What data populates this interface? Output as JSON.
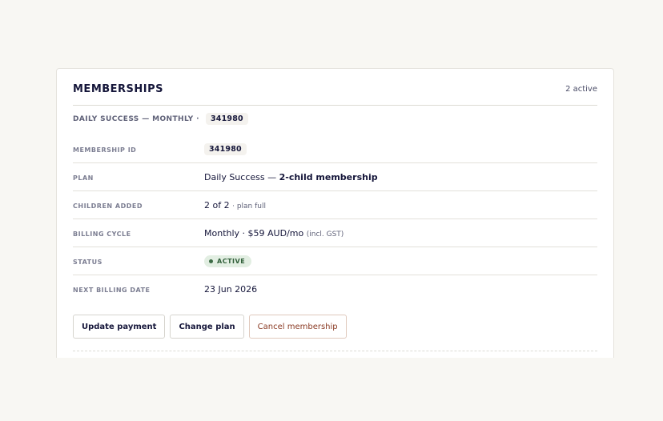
{
  "card": {
    "title": "MEMBERSHIPS",
    "count": "2 active"
  },
  "membership": {
    "header_label": "DAILY SUCCESS — MONTHLY ·",
    "header_id": "341980",
    "rows": {
      "membership_id": {
        "label": "MEMBERSHIP ID",
        "value": "341980"
      },
      "plan": {
        "label": "PLAN",
        "prefix": "Daily Success — ",
        "emphasis": "2-child membership"
      },
      "children": {
        "label": "CHILDREN ADDED",
        "value": "2 of 2",
        "note": "· plan full"
      },
      "billing": {
        "label": "BILLING CYCLE",
        "value": "Monthly · $59 AUD/mo",
        "note": "(incl. GST)"
      },
      "status": {
        "label": "STATUS",
        "value": "ACTIVE",
        "color": "#2f5e38"
      },
      "next_billing": {
        "label": "NEXT BILLING DATE",
        "value": "23 Jun 2026"
      }
    },
    "actions": {
      "update_payment": "Update payment",
      "change_plan": "Change plan",
      "cancel": "Cancel membership"
    }
  }
}
